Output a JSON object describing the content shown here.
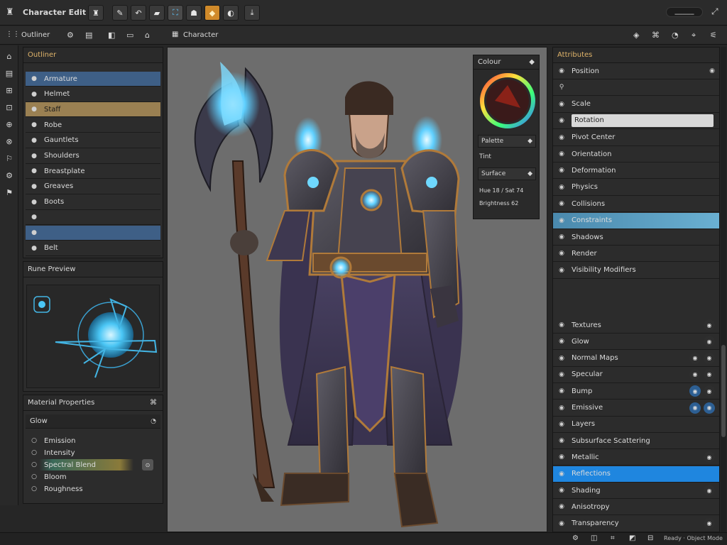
{
  "app": {
    "title": "Character Edit",
    "window_control": "▁▁▁▁▁"
  },
  "top_toolbar": {
    "icons": [
      "menu-icon",
      "undo-icon",
      "redo-icon",
      "brush-icon",
      "image-icon",
      "hand-icon",
      "gem-icon",
      "moon-icon",
      "export-icon"
    ],
    "glyphs": [
      "♜",
      "✎",
      "↶",
      "▰",
      "⛶",
      "☗",
      "◆",
      "◐",
      "⤓"
    ]
  },
  "second_toolbar": {
    "left_label": "Outliner",
    "center_label": "Character",
    "left_glyphs": [
      "⚙",
      "▤",
      "◧",
      "▭",
      "⌂"
    ],
    "right_glyphs": [
      "◈",
      "⌘",
      "◔",
      "⌖",
      "⚟"
    ]
  },
  "left_tools": [
    "⌂",
    "▤",
    "⊞",
    "⊡",
    "⊕",
    "⊗",
    "⚐",
    "⚙",
    "⚑"
  ],
  "layers_panel": {
    "title": "Outliner",
    "items": [
      {
        "icon": "●",
        "label": "Armature"
      },
      {
        "icon": "●",
        "label": "Helmet"
      },
      {
        "icon": "●",
        "label": "Staff"
      },
      {
        "icon": "●",
        "label": "Robe"
      },
      {
        "icon": "●",
        "label": "Gauntlets"
      },
      {
        "icon": "●",
        "label": "Shoulders"
      },
      {
        "icon": "●",
        "label": "Breastplate"
      },
      {
        "icon": "●",
        "label": "Greaves"
      },
      {
        "icon": "●",
        "label": "Boots"
      },
      {
        "icon": "●",
        "label": ""
      },
      {
        "icon": "●",
        "label": ""
      },
      {
        "icon": "●",
        "label": "Belt"
      }
    ]
  },
  "preview_panel": {
    "title": "Rune Preview"
  },
  "props_panel": {
    "title": "Material Properties",
    "title_right": "⌘",
    "sub": "Glow",
    "sub_right": "◔",
    "items": [
      {
        "icon": "○",
        "label": "Emission"
      },
      {
        "icon": "○",
        "label": "Intensity"
      },
      {
        "icon": "○",
        "label": "Spectral Blend"
      },
      {
        "icon": "○",
        "label": "Bloom"
      },
      {
        "icon": "○",
        "label": "Roughness"
      }
    ]
  },
  "color_panel": {
    "title": "Colour",
    "dropdown1": "Palette",
    "label2": "Tint",
    "dropdown2": "Surface",
    "line1": "Hue 18 / Sat 74",
    "line2": "Brightness 62"
  },
  "right_panel": {
    "title": "Attributes",
    "items": [
      {
        "icon": "◉",
        "label": "Position",
        "right": "◉"
      },
      {
        "icon": "⚲",
        "label": "",
        "right": ""
      },
      {
        "icon": "◉",
        "label": "Scale",
        "right": ""
      },
      {
        "icon": "◉",
        "label": "Rotation",
        "right": ""
      },
      {
        "icon": "◉",
        "label": "Pivot Center",
        "right": ""
      },
      {
        "icon": "◉",
        "label": "Orientation",
        "right": ""
      },
      {
        "icon": "◉",
        "label": "Deformation",
        "right": ""
      },
      {
        "icon": "◉",
        "label": "Physics",
        "right": ""
      },
      {
        "icon": "◉",
        "label": "Collisions",
        "right": ""
      },
      {
        "icon": "◉",
        "label": "Constraints",
        "right": ""
      },
      {
        "icon": "◉",
        "label": "Shadows",
        "right": ""
      },
      {
        "icon": "◉",
        "label": "Render",
        "right": ""
      },
      {
        "icon": "◉",
        "label": "Visibility Modifiers",
        "right": ""
      }
    ],
    "lower_items": [
      {
        "icon": "◉",
        "label": "Textures",
        "r1": "◉",
        "r2": ""
      },
      {
        "icon": "◉",
        "label": "Glow",
        "r1": "◉",
        "r2": ""
      },
      {
        "icon": "◉",
        "label": "Normal Maps",
        "r1": "◉",
        "r2": "◉"
      },
      {
        "icon": "◉",
        "label": "Specular",
        "r1": "◉",
        "r2": "◉"
      },
      {
        "icon": "◉",
        "label": "Bump",
        "r1": "◉",
        "r2": "◉"
      },
      {
        "icon": "◉",
        "label": "Emissive",
        "r1": "◉",
        "r2": "◉"
      },
      {
        "icon": "◉",
        "label": "Layers",
        "r1": "",
        "r2": ""
      },
      {
        "icon": "◉",
        "label": "Subsurface Scattering",
        "r1": "",
        "r2": ""
      },
      {
        "icon": "◉",
        "label": "Metallic",
        "r1": "◉",
        "r2": ""
      },
      {
        "icon": "◉",
        "label": "Reflections",
        "r1": "",
        "r2": ""
      },
      {
        "icon": "◉",
        "label": "Shading",
        "r1": "◉",
        "r2": ""
      },
      {
        "icon": "◉",
        "label": "Anisotropy",
        "r1": "",
        "r2": ""
      },
      {
        "icon": "◉",
        "label": "Transparency",
        "r1": "◉",
        "r2": ""
      }
    ]
  },
  "status": {
    "text": "Ready · Object Mode",
    "glyphs": [
      "⚙",
      "◫",
      "⌗",
      "◩",
      "⊟"
    ]
  },
  "colors": {
    "accent": "#1f86df",
    "gold": "#9a8052",
    "glow": "#5fd0ff"
  }
}
